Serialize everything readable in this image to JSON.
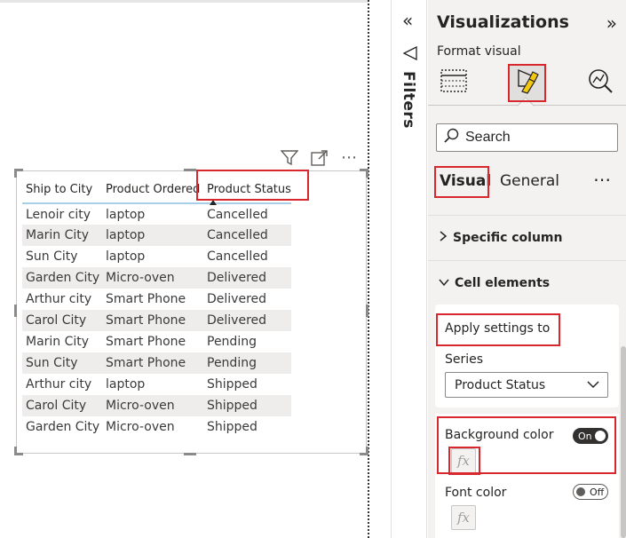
{
  "table": {
    "headers": [
      "Ship to City",
      "Product Ordered",
      "Product Status"
    ],
    "rows": [
      [
        "Lenoir city",
        "laptop",
        "Cancelled"
      ],
      [
        "Marin City",
        "laptop",
        "Cancelled"
      ],
      [
        "Sun City",
        "laptop",
        "Cancelled"
      ],
      [
        "Garden City",
        "Micro-oven",
        "Delivered"
      ],
      [
        "Arthur city",
        "Smart Phone",
        "Delivered"
      ],
      [
        "Carol City",
        "Smart Phone",
        "Delivered"
      ],
      [
        "Marin City",
        "Smart Phone",
        "Pending"
      ],
      [
        "Sun City",
        "Smart Phone",
        "Pending"
      ],
      [
        "Arthur city",
        "laptop",
        "Shipped"
      ],
      [
        "Carol City",
        "Micro-oven",
        "Shipped"
      ],
      [
        "Garden City",
        "Micro-oven",
        "Shipped"
      ]
    ]
  },
  "visual_header": {
    "icons": [
      "filter-icon",
      "focus-mode-icon",
      "more-options-icon"
    ],
    "more": "⋯"
  },
  "filters": {
    "collapse_icon": "«",
    "label": "Filters"
  },
  "viz_pane": {
    "title": "Visualizations",
    "expand_icon": "»",
    "subtitle": "Format visual",
    "search_placeholder": "Search",
    "tabs": {
      "visual": "Visual",
      "general": "General",
      "more": "⋯"
    },
    "sections": {
      "specific_column": "Specific column",
      "cell_elements": "Cell elements"
    },
    "apply_settings": {
      "label": "Apply settings to",
      "series_label": "Series",
      "series_value": "Product Status"
    },
    "background_color": {
      "label": "Background color",
      "toggle": "On",
      "fx": "fx"
    },
    "font_color": {
      "label": "Font color",
      "toggle": "Off",
      "fx": "fx"
    }
  },
  "colors": {
    "highlight_red": "#d9272e",
    "alt_row": "#eeedec",
    "header_underline": "#a9cfe8",
    "pane_bg": "#f3f2f1",
    "format_icon_yellow": "#f2c811"
  }
}
